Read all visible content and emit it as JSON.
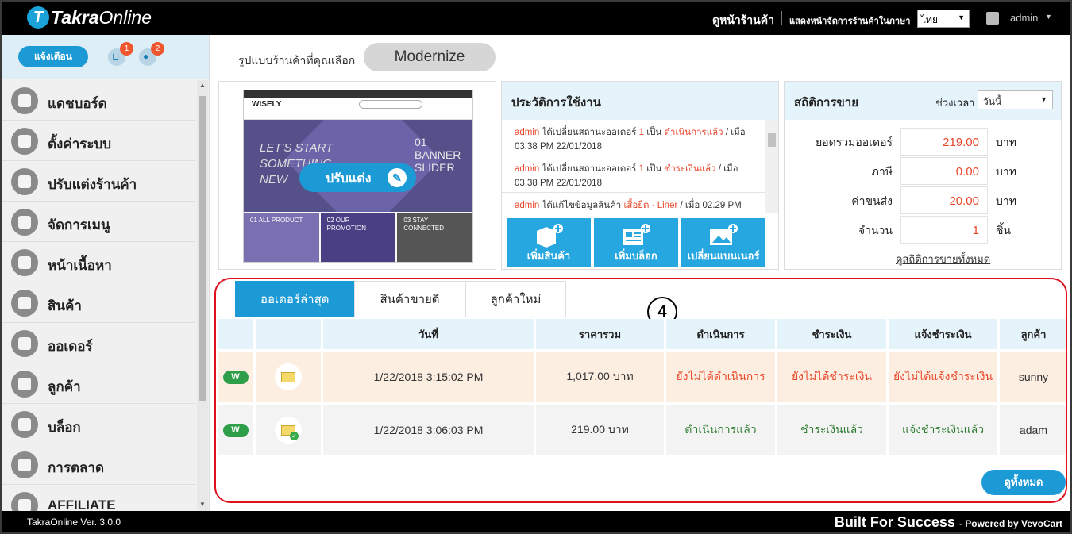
{
  "topbar": {
    "logo_mark": "T",
    "logo_bold": "Takra",
    "logo_light": "Online",
    "store_link": "ดูหน้าร้านค้า",
    "lang_label": "แสดงหน้าจัดการร้านค้าในภาษา",
    "lang_value": "ไทย",
    "user": "admin"
  },
  "sidebar": {
    "notify_label": "แจ้งเตือน",
    "cart_badge": "1",
    "user_badge": "2",
    "items": [
      {
        "label": "แดชบอร์ด",
        "icon": "dashboard-icon"
      },
      {
        "label": "ตั้งค่าระบบ",
        "icon": "gear-icon"
      },
      {
        "label": "ปรับแต่งร้านค้า",
        "icon": "monitor-icon"
      },
      {
        "label": "จัดการเมนู",
        "icon": "menu-icon"
      },
      {
        "label": "หน้าเนื้อหา",
        "icon": "page-icon"
      },
      {
        "label": "สินค้า",
        "icon": "box-icon"
      },
      {
        "label": "ออเดอร์",
        "icon": "basket-icon"
      },
      {
        "label": "ลูกค้า",
        "icon": "user-icon"
      },
      {
        "label": "บล็อก",
        "icon": "blog-icon"
      },
      {
        "label": "การตลาด",
        "icon": "chart-icon"
      },
      {
        "label": "AFFILIATE",
        "icon": "dollar-icon"
      }
    ]
  },
  "theme": {
    "label": "รูปแบบร้านค้าที่คุณเลือก",
    "name": "Modernize",
    "customize_label": "ปรับแต่ง",
    "preview": {
      "logo": "WISELY",
      "banner_left": "LET'S START SOMETHING NEW",
      "banner_right": "01 BANNER SLIDER",
      "tiles": [
        "01 ALL PRODUCT",
        "02 OUR PROMOTION",
        "03 STAY CONNECTED"
      ]
    }
  },
  "history": {
    "title": "ประวัติการใช้งาน",
    "items": [
      {
        "user": "admin",
        "pre": "ได้เปลี่ยนสถานะออเดอร์",
        "num": "1",
        "mid": "เป็น",
        "status": "ดำเนินการแล้ว",
        "post": "/ เมื่อ",
        "time": "03.38 PM 22/01/2018"
      },
      {
        "user": "admin",
        "pre": "ได้เปลี่ยนสถานะออเดอร์",
        "num": "1",
        "mid": "เป็น",
        "status": "ชำระเงินแล้ว",
        "post": "/ เมื่อ",
        "time": "03.38 PM 22/01/2018"
      },
      {
        "user": "admin",
        "pre": "ได้แก้ไขข้อมูลสินค้า",
        "num": "",
        "mid": "",
        "status": "เสื้อยืด - Liner",
        "post": "/ เมื่อ 02.29 PM",
        "time": ""
      }
    ],
    "actions": [
      "เพิ่มสินค้า",
      "เพิ่มบล็อก",
      "เปลี่ยนแบนเนอร์"
    ]
  },
  "stats": {
    "title": "สถิติการขาย",
    "period_label": "ช่วงเวลา",
    "period_value": "วันนี้",
    "rows": [
      {
        "label": "ยอดรวมออเดอร์",
        "value": "219.00",
        "unit": "บาท"
      },
      {
        "label": "ภาษี",
        "value": "0.00",
        "unit": "บาท"
      },
      {
        "label": "ค่าขนส่ง",
        "value": "20.00",
        "unit": "บาท"
      },
      {
        "label": "จำนวน",
        "value": "1",
        "unit": "ชิ้น"
      }
    ],
    "link": "ดูสถิติการขายทั้งหมด"
  },
  "orders": {
    "tabs": [
      "ออเดอร์ล่าสุด",
      "สินค้าขายดี",
      "ลูกค้าใหม่"
    ],
    "step": "4",
    "headers": [
      "",
      "",
      "วันที่",
      "ราคารวม",
      "ดำเนินการ",
      "ชำระเงิน",
      "แจ้งชำระเงิน",
      "ลูกค้า"
    ],
    "rows": [
      {
        "badge": "W",
        "date": "1/22/2018 3:15:02 PM",
        "total": "1,017.00 บาท",
        "process": "ยังไม่ได้ดำเนินการ",
        "payment": "ยังไม่ได้ชำระเงิน",
        "notify": "ยังไม่ได้แจ้งชำระเงิน",
        "customer": "sunny"
      },
      {
        "badge": "W",
        "date": "1/22/2018 3:06:03 PM",
        "total": "219.00 บาท",
        "process": "ดำเนินการแล้ว",
        "payment": "ชำระเงินแล้ว",
        "notify": "แจ้งชำระเงินแล้ว",
        "customer": "adam"
      }
    ],
    "view_all": "ดูทั้งหมด"
  },
  "footer": {
    "version": "TakraOnline Ver. 3.0.0",
    "slogan": "Built For Success",
    "powered": "- Powered by VevoCart"
  }
}
